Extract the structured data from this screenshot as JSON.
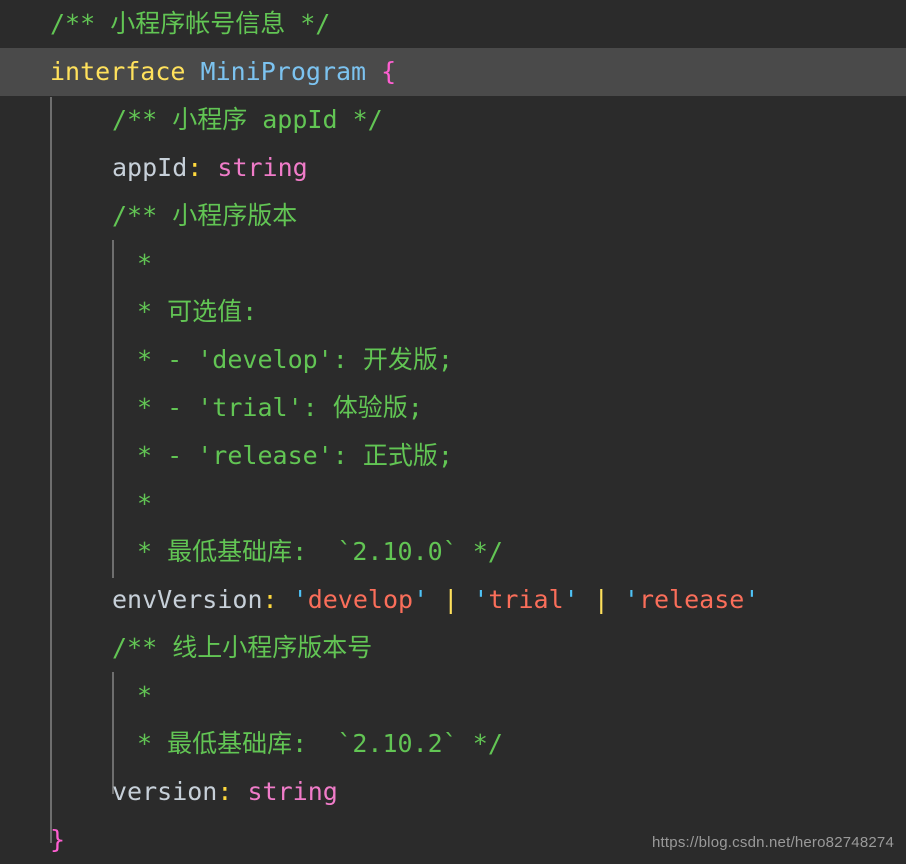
{
  "editor": {
    "language": "TypeScript",
    "theme": {
      "background": "#2b2b2b",
      "active_line_background": "#4a4a4a",
      "indent_guide": "#6e6e6e",
      "comment": "#62c554",
      "keyword": "#ffe15c",
      "type": "#7cc3f0",
      "brace": "#ff5fd2",
      "property": "#c7d0d9",
      "colon": "#ffd93d",
      "primitive_type": "#f07cc9",
      "string_quote": "#4fc3f7",
      "string_body": "#fa6e5a",
      "pipe": "#ffe15c",
      "watermark": "#9a9a9a"
    },
    "lines": [
      {
        "id": 1,
        "indent": 0,
        "active": false,
        "text": "/** 小程序帐号信息 */"
      },
      {
        "id": 2,
        "indent": 0,
        "active": true,
        "text": "interface MiniProgram {"
      },
      {
        "id": 3,
        "indent": 1,
        "active": false,
        "text": "/** 小程序 appId */"
      },
      {
        "id": 4,
        "indent": 1,
        "active": false,
        "text": "appId: string"
      },
      {
        "id": 5,
        "indent": 1,
        "active": false,
        "text": "/** 小程序版本"
      },
      {
        "id": 6,
        "indent": 1,
        "active": false,
        "text": " *"
      },
      {
        "id": 7,
        "indent": 1,
        "active": false,
        "text": " * 可选值:"
      },
      {
        "id": 8,
        "indent": 1,
        "active": false,
        "text": " * - 'develop': 开发版;"
      },
      {
        "id": 9,
        "indent": 1,
        "active": false,
        "text": " * - 'trial': 体验版;"
      },
      {
        "id": 10,
        "indent": 1,
        "active": false,
        "text": " * - 'release': 正式版;"
      },
      {
        "id": 11,
        "indent": 1,
        "active": false,
        "text": " *"
      },
      {
        "id": 12,
        "indent": 1,
        "active": false,
        "text": " * 最低基础库: `2.10.0` */"
      },
      {
        "id": 13,
        "indent": 1,
        "active": false,
        "text": "envVersion: 'develop' | 'trial' | 'release'"
      },
      {
        "id": 14,
        "indent": 1,
        "active": false,
        "text": "/** 线上小程序版本号"
      },
      {
        "id": 15,
        "indent": 1,
        "active": false,
        "text": " *"
      },
      {
        "id": 16,
        "indent": 1,
        "active": false,
        "text": " * 最低基础库: `2.10.2` */"
      },
      {
        "id": 17,
        "indent": 1,
        "active": false,
        "text": "version: string"
      },
      {
        "id": 18,
        "indent": 0,
        "active": false,
        "text": "}"
      }
    ],
    "tokens": {
      "l1_comment": "/** 小程序帐号信息 */",
      "l2_keyword": "interface",
      "l2_space1": " ",
      "l2_type": "MiniProgram",
      "l2_space2": " ",
      "l2_brace": "{",
      "l3_comment": "/** 小程序 appId */",
      "l4_prop": "appId",
      "l4_colon": ":",
      "l4_space": " ",
      "l4_type": "string",
      "l5_comment": "/** 小程序版本",
      "l6_comment": " *",
      "l7_comment": " * 可选值:",
      "l8_comment": " * - 'develop': 开发版;",
      "l9_comment": " * - 'trial': 体验版;",
      "l10_comment": " * - 'release': 正式版;",
      "l11_comment": " *",
      "l12_comment": " * 最低基础库:  `2.10.0` */",
      "l13_prop": "envVersion",
      "l13_colon": ":",
      "l13_sp1": " ",
      "l13_q1": "'",
      "l13_s1": "develop",
      "l13_q2": "'",
      "l13_sp2": " ",
      "l13_pipe1": "|",
      "l13_sp3": " ",
      "l13_q3": "'",
      "l13_s2": "trial",
      "l13_q4": "'",
      "l13_sp4": " ",
      "l13_pipe2": "|",
      "l13_sp5": " ",
      "l13_q5": "'",
      "l13_s3": "release",
      "l13_q6": "'",
      "l14_comment": "/** 线上小程序版本号",
      "l15_comment": " *",
      "l16_comment": " * 最低基础库:  `2.10.2` */",
      "l17_prop": "version",
      "l17_colon": ":",
      "l17_space": " ",
      "l17_type": "string",
      "l18_brace": "}"
    }
  },
  "watermark": {
    "text": "https://blog.csdn.net/hero82748274"
  }
}
